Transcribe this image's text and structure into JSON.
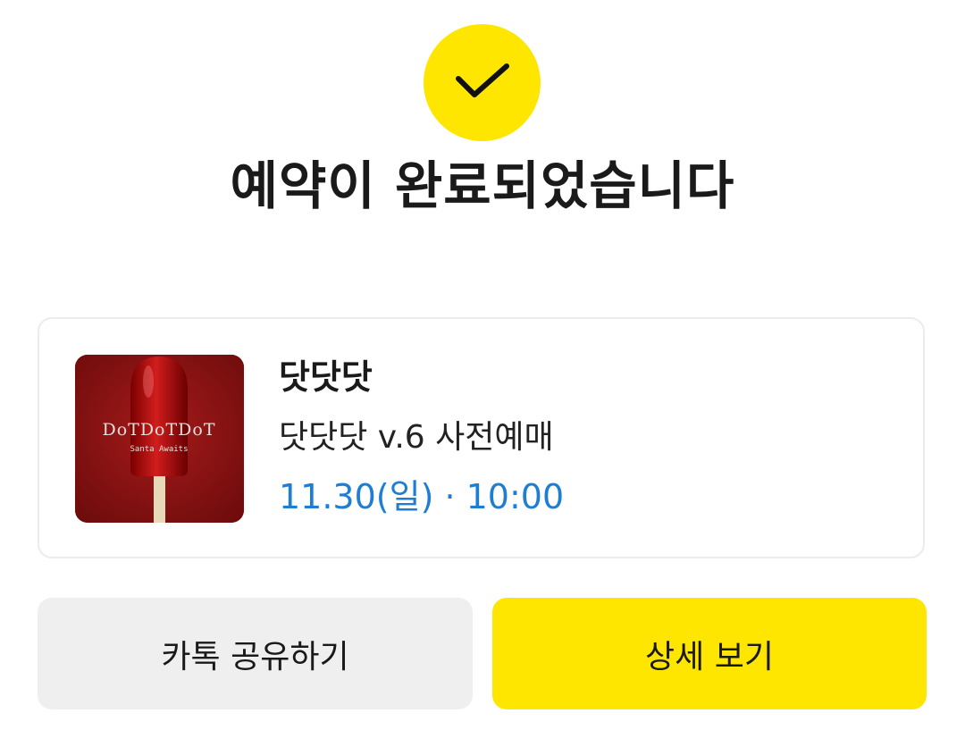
{
  "header": {
    "title": "예약이 완료되었습니다",
    "check_color": "#FFE600"
  },
  "reservation": {
    "poster_text": "DoTDoTDoT",
    "poster_subtext": "Santa Awaits",
    "event_name": "닷닷닷",
    "event_subtitle": "닷닷닷 v.6 사전예매",
    "event_datetime": "11.30(일) · 10:00"
  },
  "actions": {
    "share_label": "카톡 공유하기",
    "detail_label": "상세 보기"
  },
  "colors": {
    "accent": "#FFE600",
    "date_text": "#1f7ed2"
  },
  "icons": {
    "check": "check-icon"
  }
}
